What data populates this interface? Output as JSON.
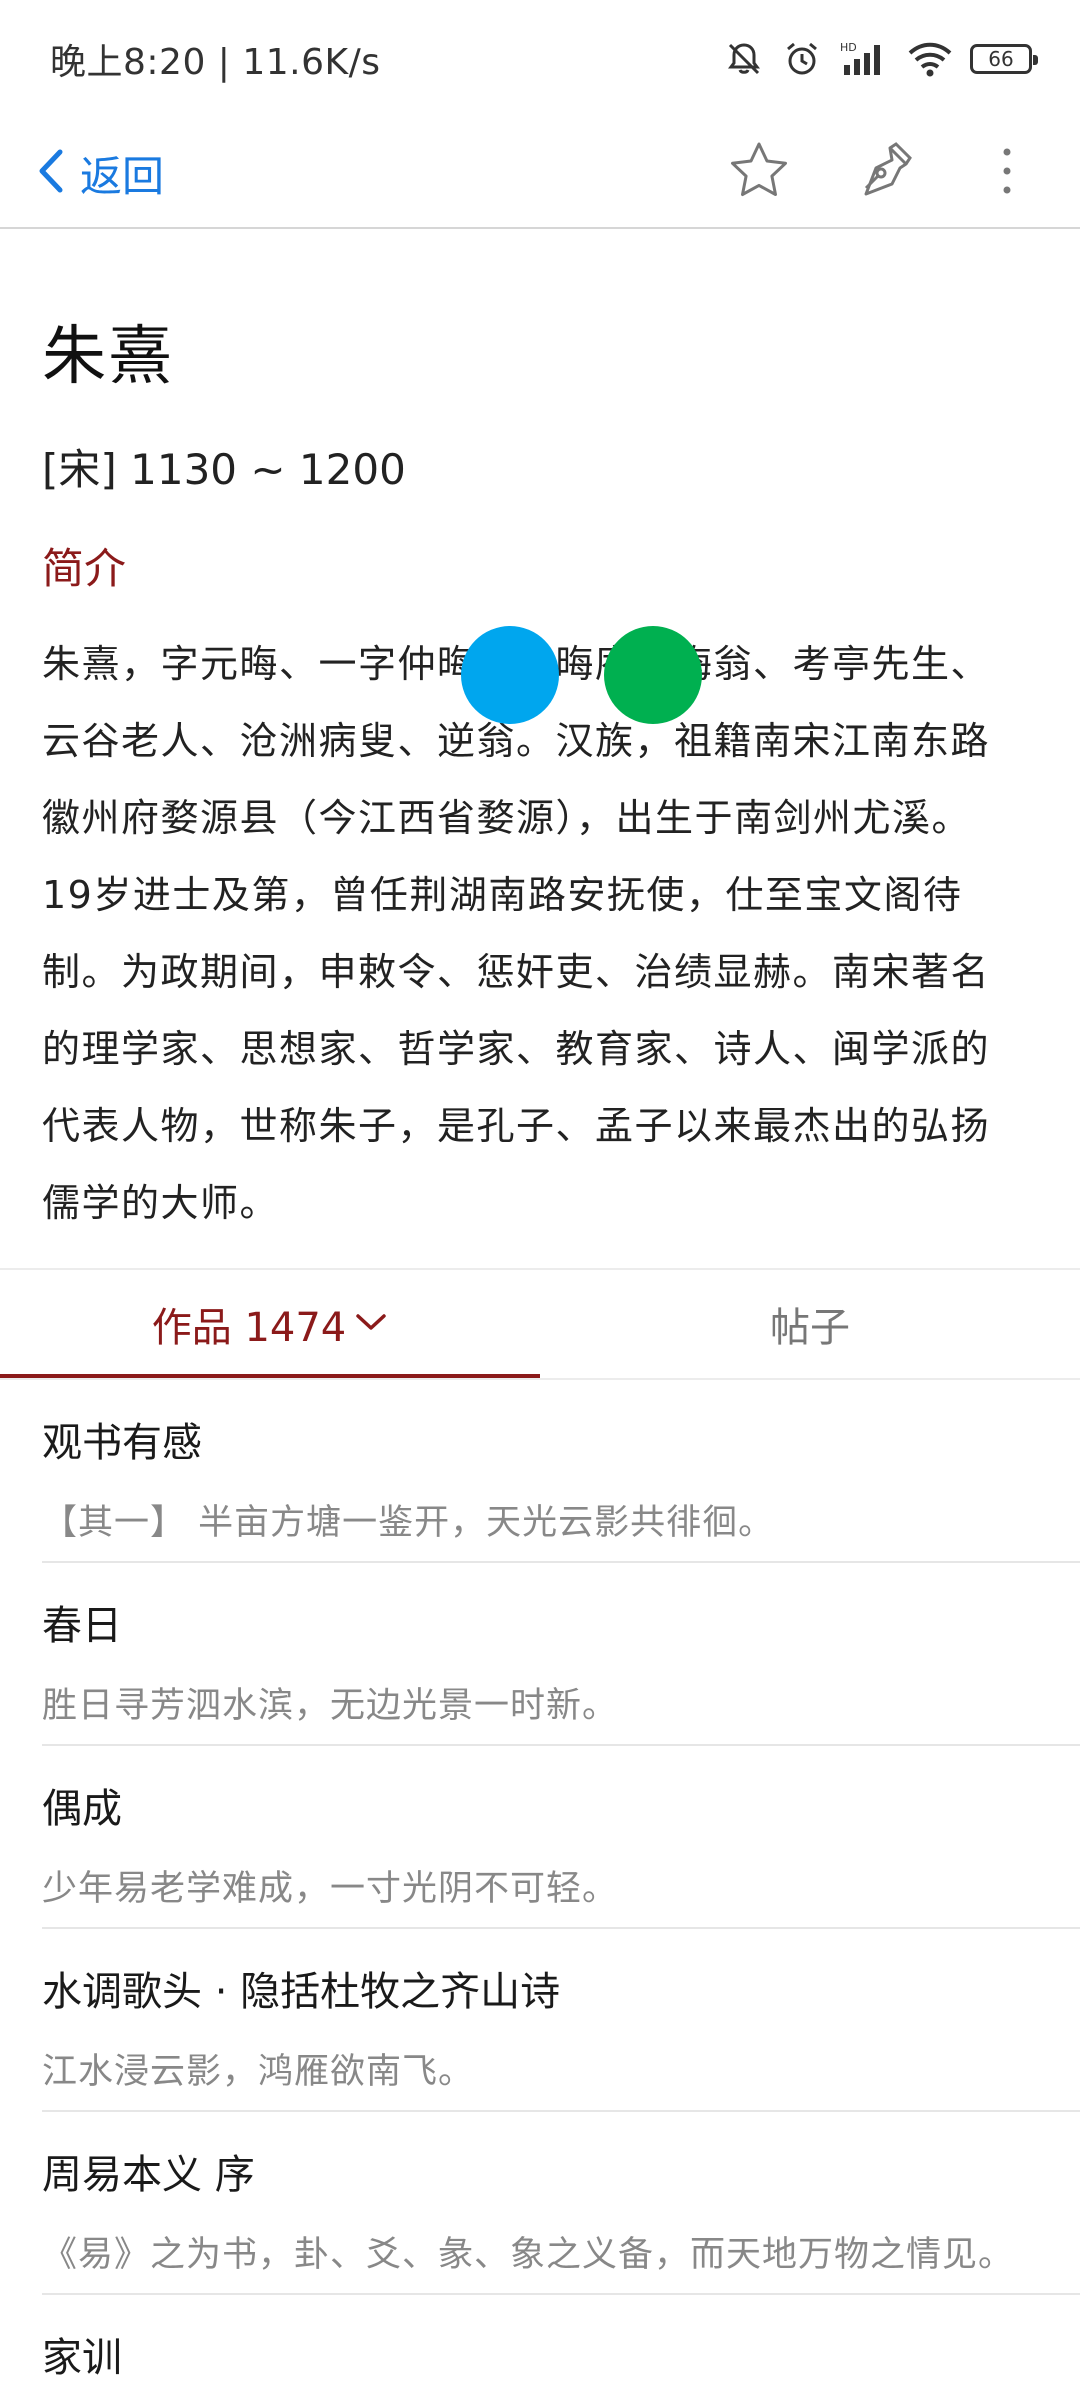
{
  "status_bar": {
    "time_speed": "晚上8:20 | 11.6K/s",
    "battery": "66"
  },
  "nav": {
    "back_label": "返回"
  },
  "author": {
    "name": "朱熹",
    "dates": "[宋] 1130 ~ 1200",
    "intro_heading": "简介",
    "bio_lines": [
      "朱熹，字元晦、一字仲晦，号晦庵、晦翁、考亭先生、",
      "云谷老人、沧洲病叟、逆翁。汉族，祖籍南宋江南东路",
      "徽州府婺源县（今江西省婺源），出生于南剑州尤溪。",
      "19岁进士及第，曾任荆湖南路安抚使，仕至宝文阁待",
      "制。为政期间，申敕令、惩奸吏、治绩显赫。南宋著名",
      "的理学家、思想家、哲学家、教育家、诗人、闽学派的",
      "代表人物，世称朱子，是孔子、孟子以来最杰出的弘扬",
      "儒学的大师。"
    ]
  },
  "tabs": {
    "works_label": "作品 1474",
    "posts_label": "帖子"
  },
  "works": [
    {
      "title": "观书有感",
      "excerpt": "【其一】 半亩方塘一鉴开，天光云影共徘徊。"
    },
    {
      "title": "春日",
      "excerpt": "胜日寻芳泗水滨，无边光景一时新。"
    },
    {
      "title": "偶成",
      "excerpt": "少年易老学难成，一寸光阴不可轻。"
    },
    {
      "title": "水调歌头 · 隐括杜牧之齐山诗",
      "excerpt": "江水浸云影，鸿雁欲南飞。"
    },
    {
      "title": "周易本义 序",
      "excerpt": "《易》之为书，卦、爻、彖、象之义备，而天地万物之情见。"
    },
    {
      "title": "家训",
      "excerpt": ""
    }
  ],
  "colors": {
    "accent_red": "#8b1a1a",
    "link_blue": "#1a7ae0",
    "overlay_blue": "#00a6ee",
    "overlay_green": "#00b050"
  }
}
